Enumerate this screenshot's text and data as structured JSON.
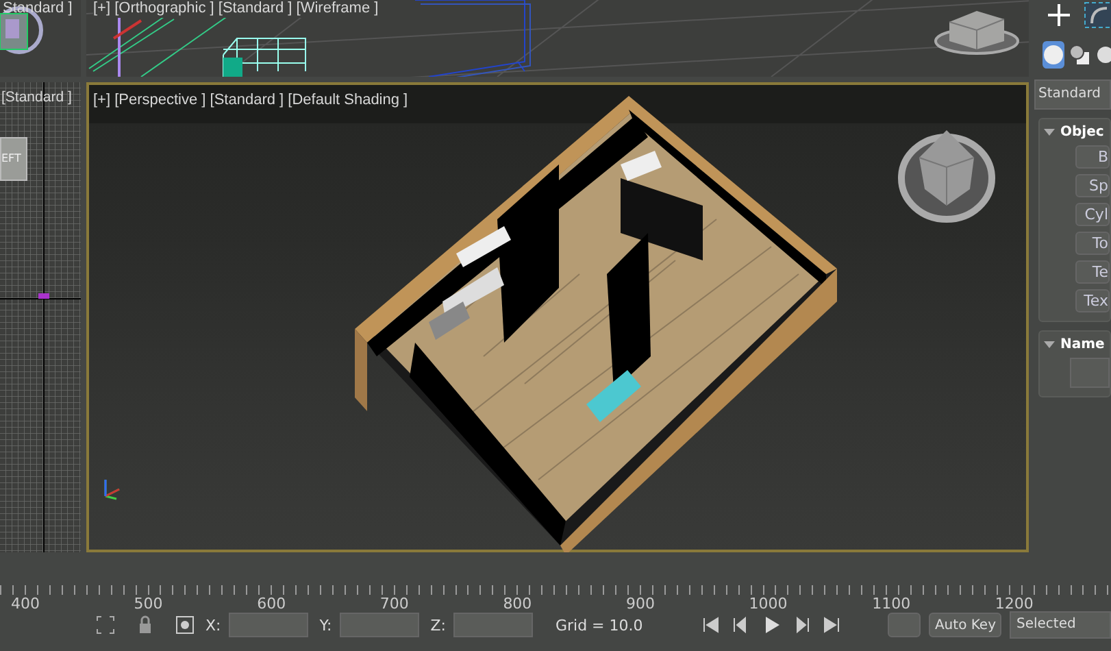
{
  "viewports": {
    "top_left": {
      "label": "Standard ]"
    },
    "top": {
      "label": "[+] [Orthographic ] [Standard ] [Wireframe ]"
    },
    "left": {
      "label": "[Standard ]",
      "viewcube": "EFT"
    },
    "perspective": {
      "label": "[+] [Perspective ] [Standard ] [Default Shading ]",
      "active": true
    }
  },
  "command_panel": {
    "categories": [
      {
        "kind": "geometry",
        "selected": true
      },
      {
        "kind": "shapes",
        "selected": false
      },
      {
        "kind": "lights",
        "selected": false
      }
    ],
    "dropdown": "Standard",
    "rollouts": [
      {
        "title": "Objec",
        "expanded": true,
        "buttons": [
          "B",
          "Sp",
          "Cyl",
          "To",
          "Te",
          "Tex"
        ]
      },
      {
        "title": "Name",
        "expanded": true
      }
    ]
  },
  "timeline": {
    "labels": [
      "400",
      "500",
      "600",
      "700",
      "800",
      "900",
      "1000",
      "1100",
      "1200"
    ]
  },
  "status_bar": {
    "coords": [
      {
        "label": "X:"
      },
      {
        "label": "Y:"
      },
      {
        "label": "Z:"
      }
    ],
    "grid": "Grid = 10.0",
    "auto_key": {
      "label": "Auto Key",
      "on": false
    },
    "key_mode": "Selected"
  }
}
